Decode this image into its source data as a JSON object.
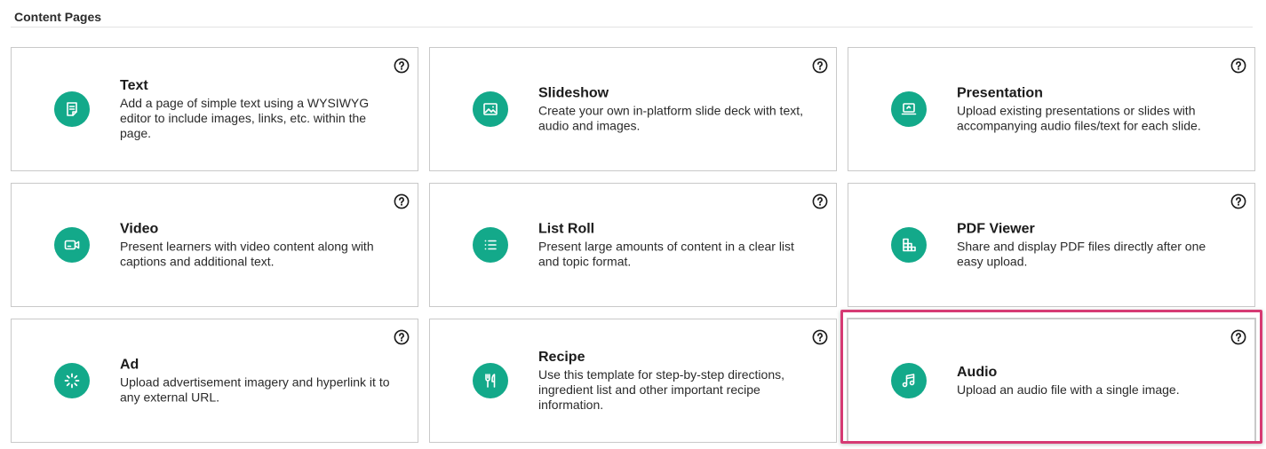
{
  "section": {
    "title": "Content Pages"
  },
  "colors": {
    "accent": "#13a98a",
    "highlight": "#d63a73",
    "border": "#c9c9c9"
  },
  "cards": [
    {
      "title": "Text",
      "description": "Add a page of simple text using a WYSIWYG editor to include images, links, etc. within the page.",
      "icon": "document-icon"
    },
    {
      "title": "Slideshow",
      "description": "Create your own in-platform slide deck with text, audio and images.",
      "icon": "image-icon"
    },
    {
      "title": "Presentation",
      "description": "Upload existing presentations or slides with accompanying audio files/text for each slide.",
      "icon": "presentation-icon"
    },
    {
      "title": "Video",
      "description": "Present learners with video content along with captions and additional text.",
      "icon": "video-icon"
    },
    {
      "title": "List Roll",
      "description": "Present large amounts of content in a clear list and topic format.",
      "icon": "list-icon"
    },
    {
      "title": "PDF Viewer",
      "description": "Share and display PDF files directly after one easy upload.",
      "icon": "pdf-grid-icon"
    },
    {
      "title": "Ad",
      "description": "Upload advertisement imagery and hyperlink it to any external URL.",
      "icon": "loader-icon"
    },
    {
      "title": "Recipe",
      "description": "Use this template for step-by-step directions, ingredient list and other important recipe information.",
      "icon": "utensils-icon"
    },
    {
      "title": "Audio",
      "description": "Upload an audio file with a single image.",
      "icon": "music-note-icon"
    }
  ]
}
